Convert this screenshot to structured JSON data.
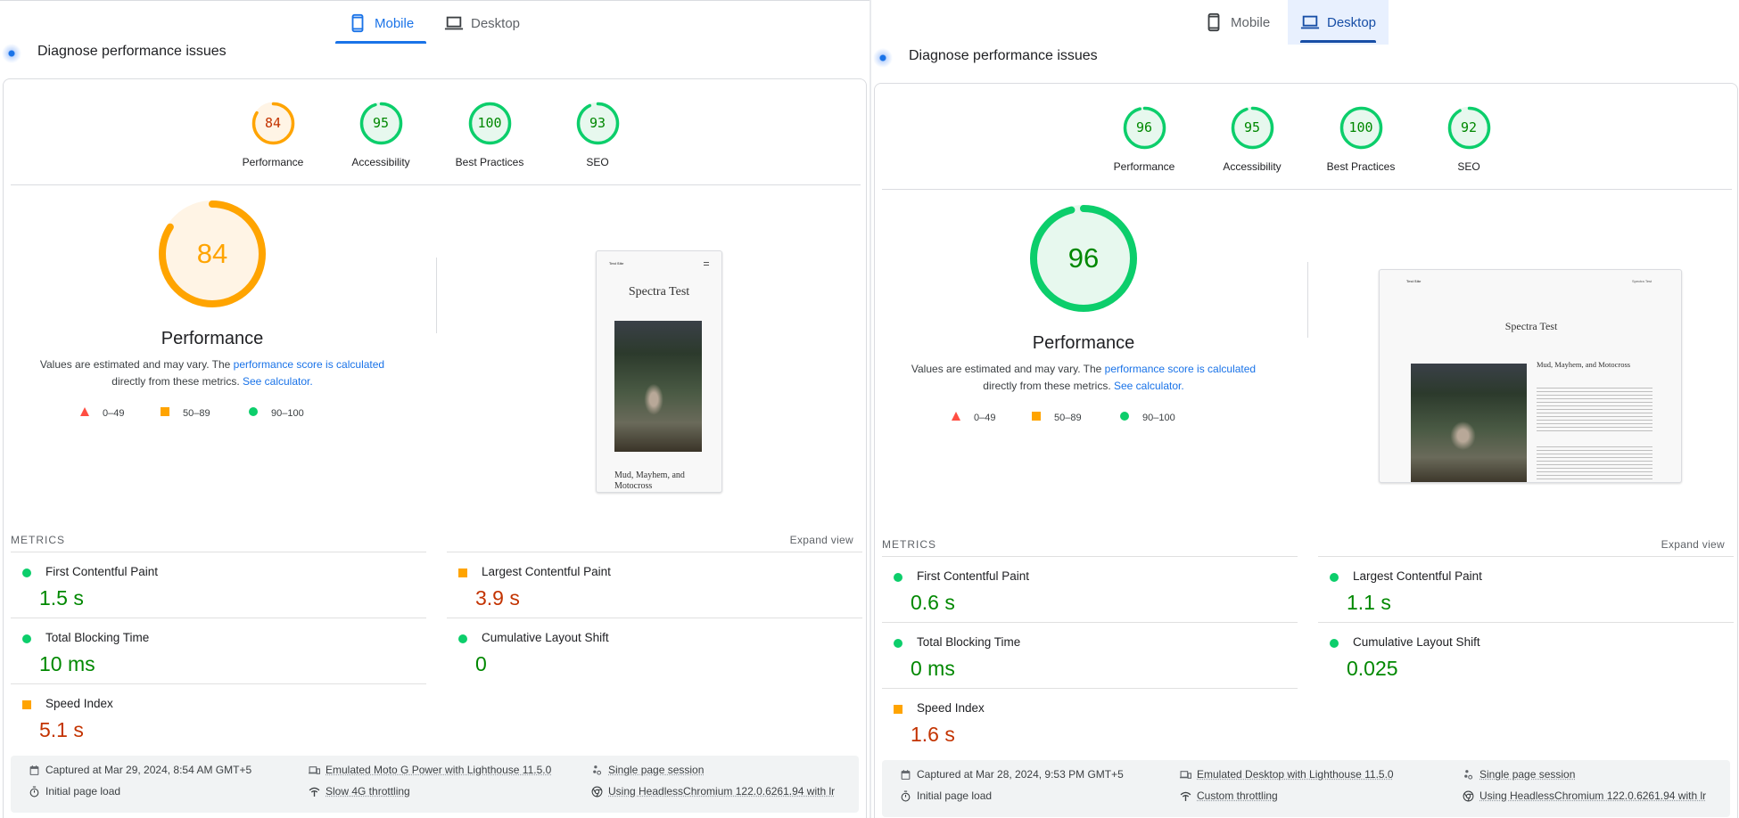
{
  "colors": {
    "pass": "#0cce6b",
    "pass_text": "#008800",
    "average": "#ffa400",
    "average_text": "#c33300",
    "fail": "#ff4e42",
    "link": "#1a73e8"
  },
  "panels": [
    {
      "tabs": [
        {
          "label": "Mobile",
          "icon": "smartphone-icon",
          "active": true
        },
        {
          "label": "Desktop",
          "icon": "laptop-icon",
          "active": false
        }
      ],
      "header": {
        "icon": "lighthouse-icon",
        "title": "Diagnose performance issues"
      },
      "gauges": [
        {
          "label": "Performance",
          "score": 84,
          "rating": "average"
        },
        {
          "label": "Accessibility",
          "score": 95,
          "rating": "pass"
        },
        {
          "label": "Best Practices",
          "score": 100,
          "rating": "pass"
        },
        {
          "label": "SEO",
          "score": 93,
          "rating": "pass"
        }
      ],
      "main_gauge": {
        "score": 84,
        "rating": "average",
        "title": "Performance"
      },
      "description": {
        "before": "Values are estimated and may vary. The ",
        "link1": "performance score is calculated",
        "middle": " directly from these metrics. ",
        "link2": "See calculator."
      },
      "legend": [
        {
          "shape": "triangle",
          "range": "0–49"
        },
        {
          "shape": "square",
          "range": "50–89"
        },
        {
          "shape": "circle",
          "range": "90–100"
        }
      ],
      "screenshot": {
        "type": "mobile",
        "site_name": "Test Site",
        "title": "Spectra Test",
        "heading": "Mud, Mayhem, and Motocross"
      },
      "metrics_title": "METRICS",
      "expand_label": "Expand view",
      "metrics": [
        {
          "label": "First Contentful Paint",
          "value": "1.5 s",
          "rating": "pass"
        },
        {
          "label": "Largest Contentful Paint",
          "value": "3.9 s",
          "rating": "average"
        },
        {
          "label": "Total Blocking Time",
          "value": "10 ms",
          "rating": "pass"
        },
        {
          "label": "Cumulative Layout Shift",
          "value": "0",
          "rating": "pass"
        },
        {
          "label": "Speed Index",
          "value": "5.1 s",
          "rating": "average"
        }
      ],
      "footer": [
        {
          "icon": "calendar-icon",
          "text": "Captured at Mar 29, 2024, 8:54 AM GMT+5",
          "link": false
        },
        {
          "icon": "devices-icon",
          "text": "Emulated Moto G Power with Lighthouse 11.5.0",
          "link": true
        },
        {
          "icon": "session-icon",
          "text": "Single page session",
          "link": true
        },
        {
          "icon": "timer-icon",
          "text": "Initial page load",
          "link": false
        },
        {
          "icon": "network-icon",
          "text": "Slow 4G throttling",
          "link": true
        },
        {
          "icon": "chrome-icon",
          "text": "Using HeadlessChromium 122.0.6261.94 with lr",
          "link": true
        }
      ]
    },
    {
      "tabs": [
        {
          "label": "Mobile",
          "icon": "smartphone-icon",
          "active": false
        },
        {
          "label": "Desktop",
          "icon": "laptop-icon",
          "active": true
        }
      ],
      "header": {
        "icon": "lighthouse-icon",
        "title": "Diagnose performance issues"
      },
      "gauges": [
        {
          "label": "Performance",
          "score": 96,
          "rating": "pass"
        },
        {
          "label": "Accessibility",
          "score": 95,
          "rating": "pass"
        },
        {
          "label": "Best Practices",
          "score": 100,
          "rating": "pass"
        },
        {
          "label": "SEO",
          "score": 92,
          "rating": "pass"
        }
      ],
      "main_gauge": {
        "score": 96,
        "rating": "pass",
        "title": "Performance"
      },
      "description": {
        "before": "Values are estimated and may vary. The ",
        "link1": "performance score is calculated",
        "middle": " directly from these metrics. ",
        "link2": "See calculator."
      },
      "legend": [
        {
          "shape": "triangle",
          "range": "0–49"
        },
        {
          "shape": "square",
          "range": "50–89"
        },
        {
          "shape": "circle",
          "range": "90–100"
        }
      ],
      "screenshot": {
        "type": "desktop",
        "site_name": "Test Site",
        "nav_link": "Spectra Test",
        "title": "Spectra Test",
        "heading": "Mud, Mayhem, and Motocross"
      },
      "metrics_title": "METRICS",
      "expand_label": "Expand view",
      "metrics": [
        {
          "label": "First Contentful Paint",
          "value": "0.6 s",
          "rating": "pass"
        },
        {
          "label": "Largest Contentful Paint",
          "value": "1.1 s",
          "rating": "pass"
        },
        {
          "label": "Total Blocking Time",
          "value": "0 ms",
          "rating": "pass"
        },
        {
          "label": "Cumulative Layout Shift",
          "value": "0.025",
          "rating": "pass"
        },
        {
          "label": "Speed Index",
          "value": "1.6 s",
          "rating": "average"
        }
      ],
      "footer": [
        {
          "icon": "calendar-icon",
          "text": "Captured at Mar 28, 2024, 9:53 PM GMT+5",
          "link": false
        },
        {
          "icon": "devices-icon",
          "text": "Emulated Desktop with Lighthouse 11.5.0",
          "link": true
        },
        {
          "icon": "session-icon",
          "text": "Single page session",
          "link": true
        },
        {
          "icon": "timer-icon",
          "text": "Initial page load",
          "link": false
        },
        {
          "icon": "network-icon",
          "text": "Custom throttling",
          "link": true
        },
        {
          "icon": "chrome-icon",
          "text": "Using HeadlessChromium 122.0.6261.94 with lr",
          "link": true
        }
      ]
    }
  ]
}
